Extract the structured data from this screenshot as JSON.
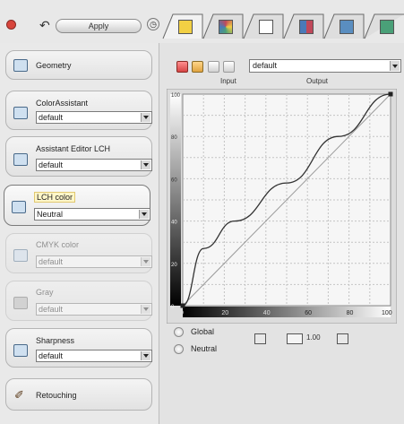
{
  "toolbar": {
    "apply_label": "Apply",
    "tabs": [
      {
        "icon": "pencil-color-icon",
        "color": "#f2d044"
      },
      {
        "icon": "color-wheel-icon",
        "color": "#c0485a"
      },
      {
        "icon": "document-icon",
        "color": "#ffffff"
      },
      {
        "icon": "color-grid-icon",
        "color": "#4a7ab8"
      },
      {
        "icon": "info-icon",
        "color": "#5a8ec0"
      },
      {
        "icon": "globe-icon",
        "color": "#4aa078"
      }
    ]
  },
  "modules": [
    {
      "title": "Geometry",
      "value": null,
      "state": "normal"
    },
    {
      "title": "ColorAssistant",
      "value": "default",
      "state": "normal"
    },
    {
      "title": "Assistant Editor LCH",
      "value": "default",
      "state": "normal"
    },
    {
      "title": "LCH color",
      "value": "Neutral",
      "state": "active"
    },
    {
      "title": "CMYK color",
      "value": "default",
      "state": "disabled"
    },
    {
      "title": "Gray",
      "value": "default",
      "state": "disabled"
    },
    {
      "title": "Sharpness",
      "value": "default",
      "state": "normal"
    },
    {
      "title": "Retouching",
      "value": null,
      "state": "normal"
    }
  ],
  "curve_editor": {
    "preset": "default",
    "input_label": "Input",
    "output_label": "Output",
    "y_ticks": [
      "100",
      "80",
      "60",
      "40",
      "20",
      "0"
    ],
    "x_ticks": [
      "0",
      "20",
      "40",
      "60",
      "80",
      "100"
    ],
    "mode_options": [
      "Global",
      "Neutral"
    ],
    "gamma_label": "1.00"
  },
  "chart_data": {
    "type": "line",
    "xlim": [
      0,
      100
    ],
    "ylim": [
      0,
      100
    ],
    "grid": true,
    "series": [
      {
        "values": [
          [
            0,
            0
          ],
          [
            100,
            100
          ]
        ]
      },
      {
        "values": [
          [
            0,
            0
          ],
          [
            10,
            27
          ],
          [
            25,
            40
          ],
          [
            50,
            58
          ],
          [
            75,
            80
          ],
          [
            100,
            100
          ]
        ]
      }
    ]
  }
}
